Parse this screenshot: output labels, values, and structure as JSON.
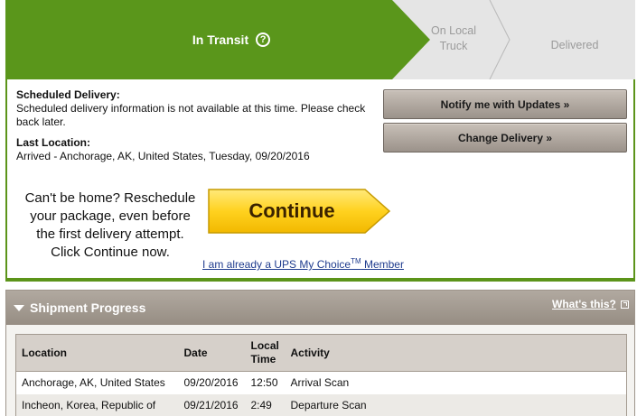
{
  "status": {
    "current_step": "In Transit",
    "steps": [
      "On Local Truck",
      "Delivered"
    ],
    "colors": {
      "active": "#5a961b",
      "inactive": "#e5e5e5",
      "inactive_text": "#9b9b9b"
    }
  },
  "delivery": {
    "scheduled_label": "Scheduled Delivery:",
    "scheduled_text": "Scheduled delivery information is not available at this time. Please check back later.",
    "last_location_label": "Last Location:",
    "last_location_text": "Arrived - Anchorage, AK, United States, Tuesday, 09/20/2016",
    "notify_button": "Notify me with Updates »",
    "change_button": "Change Delivery »"
  },
  "promo": {
    "line1": "Can't be home? Reschedule",
    "line2": "your package, even before",
    "line3": "the first delivery attempt.",
    "line4": "Click Continue now.",
    "continue_button": "Continue",
    "mychoice_link_text": "I am already a UPS My Choice",
    "mychoice_link_tm": "TM",
    "mychoice_link_suffix": " Member"
  },
  "progress": {
    "title": "Shipment Progress",
    "whats_this": "What's this?",
    "columns": {
      "location": "Location",
      "date": "Date",
      "time_line1": "Local",
      "time_line2": "Time",
      "activity": "Activity"
    },
    "rows": [
      {
        "location": "Anchorage, AK, United States",
        "date": "09/20/2016",
        "time": "12:50",
        "activity": "Arrival Scan"
      },
      {
        "location": "Incheon, Korea, Republic of",
        "date": "09/21/2016",
        "time": "2:49",
        "activity": "Departure Scan"
      }
    ]
  }
}
